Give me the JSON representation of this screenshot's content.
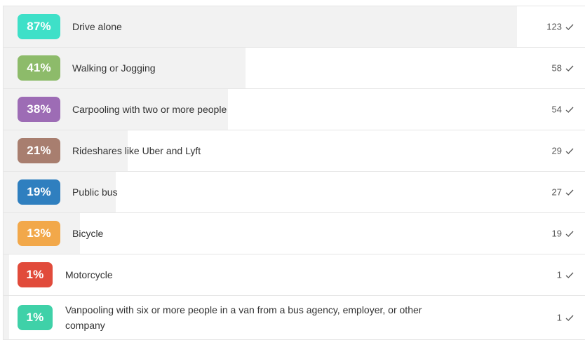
{
  "poll": {
    "options": [
      {
        "percent": 87,
        "percent_label": "87%",
        "label": "Drive alone",
        "count": "123",
        "color": "#3ee0c8"
      },
      {
        "percent": 41,
        "percent_label": "41%",
        "label": "Walking or Jogging",
        "count": "58",
        "color": "#8dbb6a"
      },
      {
        "percent": 38,
        "percent_label": "38%",
        "label": "Carpooling with two or more people",
        "count": "54",
        "color": "#9d6cb5"
      },
      {
        "percent": 21,
        "percent_label": "21%",
        "label": "Rideshares like Uber and Lyft",
        "count": "29",
        "color": "#a87e6f"
      },
      {
        "percent": 19,
        "percent_label": "19%",
        "label": "Public bus",
        "count": "27",
        "color": "#2f7fbf"
      },
      {
        "percent": 13,
        "percent_label": "13%",
        "label": "Bicycle",
        "count": "19",
        "color": "#f2a84a"
      },
      {
        "percent": 1,
        "percent_label": "1%",
        "label": "Motorcycle",
        "count": "1",
        "color": "#e14b3b"
      },
      {
        "percent": 1,
        "percent_label": "1%",
        "label": "Vanpooling with six or more people in a van from a bus agency, employer, or other company",
        "count": "1",
        "color": "#3fd1a8"
      }
    ],
    "check_icon": "checkmark-icon"
  }
}
